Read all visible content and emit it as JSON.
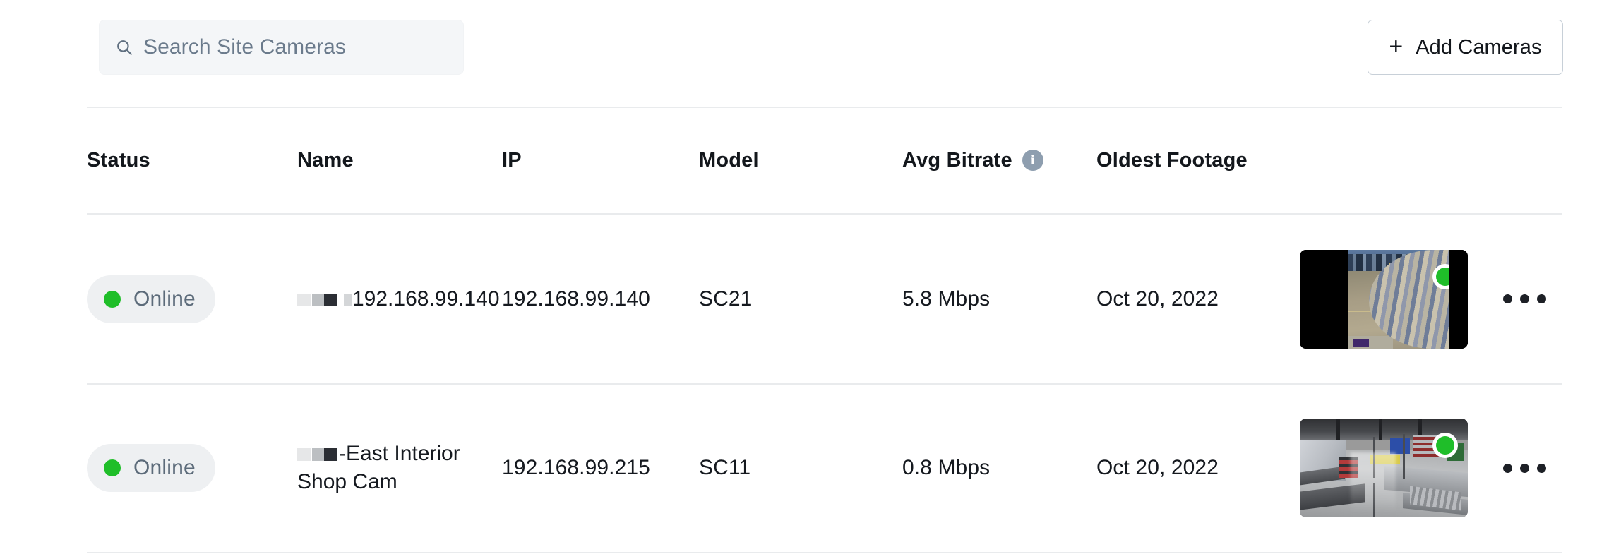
{
  "toolbar": {
    "search": {
      "placeholder": "Search Site Cameras",
      "value": "",
      "icon": "search-icon"
    },
    "add_cameras": {
      "label": "Add Cameras",
      "plus_glyph": "+",
      "icon": "plus-icon"
    }
  },
  "table": {
    "columns": [
      {
        "key": "status",
        "label": "Status"
      },
      {
        "key": "name",
        "label": "Name"
      },
      {
        "key": "ip",
        "label": "IP"
      },
      {
        "key": "model",
        "label": "Model"
      },
      {
        "key": "bitrate",
        "label": "Avg Bitrate",
        "info_icon": "info-icon",
        "info_glyph": "i"
      },
      {
        "key": "footage",
        "label": "Oldest Footage"
      }
    ],
    "rows": [
      {
        "status": "Online",
        "status_color": "#1fbe29",
        "name": "192.168.99.140",
        "name_prefix_redacted": true,
        "ip": "192.168.99.140",
        "model": "SC21",
        "bitrate": "5.8 Mbps",
        "footage": "Oct 20, 2022",
        "thumbnail": "exterior-parking-lot-fisheye",
        "live_indicator": "online-dot",
        "actions_icon": "ellipsis-icon"
      },
      {
        "status": "Online",
        "status_color": "#1fbe29",
        "name": "-East Interior Shop Cam",
        "name_prefix_redacted": true,
        "ip": "192.168.99.215",
        "model": "SC11",
        "bitrate": "0.8 Mbps",
        "footage": "Oct 20, 2022",
        "thumbnail": "interior-shop-floor",
        "live_indicator": "online-dot",
        "actions_icon": "ellipsis-icon"
      }
    ]
  },
  "colors": {
    "online_green": "#1fbe29",
    "pill_background": "#eef0f2",
    "pill_text": "#5c6b7a",
    "search_background": "#f4f6f8",
    "divider": "#e9ebed",
    "info_icon": "#8e9eaf",
    "text_primary": "#15191f",
    "button_border": "#c8d0d8"
  }
}
